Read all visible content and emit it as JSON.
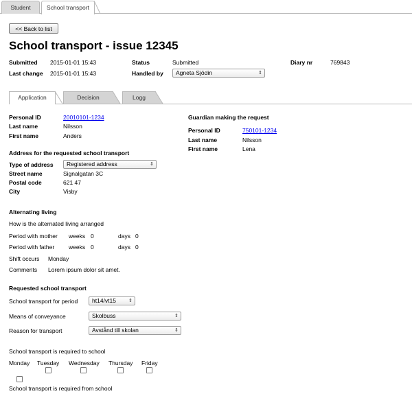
{
  "top_tabs": [
    "Student",
    "School transport"
  ],
  "back_button": "<< Back to list",
  "page_title": "School transport - issue 12345",
  "meta": {
    "submitted_label": "Submitted",
    "submitted_value": "2015-01-01 15:43",
    "last_change_label": "Last change",
    "last_change_value": "2015-01-01 15:43",
    "status_label": "Status",
    "status_value": "Submitted",
    "handled_by_label": "Handled by",
    "handled_by_value": "Agneta Sjödin",
    "diary_label": "Diary nr",
    "diary_value": "769843"
  },
  "inner_tabs": [
    "Application",
    "Decision",
    "Logg"
  ],
  "student": {
    "personal_id_label": "Personal ID",
    "personal_id_value": "20010101-1234",
    "last_name_label": "Last name",
    "last_name_value": "Nilsson",
    "first_name_label": "First name",
    "first_name_value": "Anders"
  },
  "guardian": {
    "heading": "Guardian making the request",
    "personal_id_label": "Personal ID",
    "personal_id_value": "750101-1234",
    "last_name_label": "Last name",
    "last_name_value": "Nilsson",
    "first_name_label": "First name",
    "first_name_value": "Lena"
  },
  "address": {
    "heading": "Address for the requested school transport",
    "type_label": "Type of address",
    "type_value": "Registered address",
    "street_label": "Street name",
    "street_value": "Signalgatan 3C",
    "postal_label": "Postal code",
    "postal_value": "621 47",
    "city_label": "City",
    "city_value": "Visby"
  },
  "alternating": {
    "heading": "Alternating living",
    "question": "How is the alternated living arranged",
    "mother_label": "Period with mother",
    "father_label": "Period with father",
    "weeks_label": "weeks",
    "days_label": "days",
    "mother_weeks": "0",
    "mother_days": "0",
    "father_weeks": "0",
    "father_days": "0",
    "shift_label": "Shift occurs",
    "shift_value": "Monday",
    "comments_label": "Comments",
    "comments_value": "Lorem ipsum dolor sit amet."
  },
  "requested": {
    "heading": "Requested school transport",
    "period_label": "School transport for period",
    "period_value": "ht14/vt15",
    "means_label": "Means of conveyance",
    "means_value": "Skolbuss",
    "reason_label": "Reason for transport",
    "reason_value": "Avstånd till skolan",
    "to_school_label": "School transport is required to school",
    "days": [
      "Monday",
      "Tuesday",
      "Wednesday",
      "Thursday",
      "Friday"
    ],
    "from_school_label": "School transport is required from school"
  }
}
